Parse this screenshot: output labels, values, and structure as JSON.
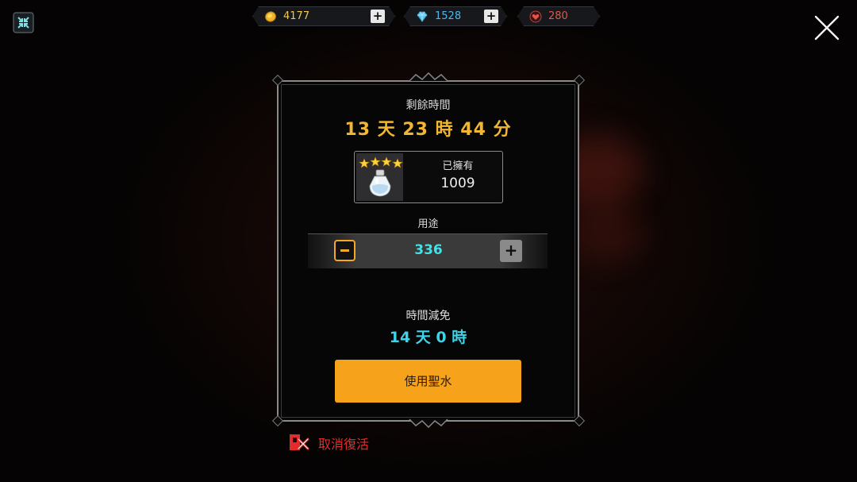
{
  "resources": {
    "gold": {
      "icon": "gold-coin-icon",
      "value": "4177",
      "plus": "+"
    },
    "gem": {
      "icon": "diamond-icon",
      "value": "1528",
      "plus": "+"
    },
    "heart": {
      "icon": "heart-icon",
      "value": "280"
    }
  },
  "panel": {
    "remaining_label": "剩餘時間",
    "remaining_time": "13 天 23 時 44 分",
    "owned_label": "已擁有",
    "owned_value": "1009",
    "item_icon": "holy-water-potion-icon",
    "item_stars": 4,
    "usage_label": "用途",
    "quantity": "336",
    "minus": "−",
    "plus": "+",
    "reduction_label": "時間減免",
    "reduction_value": "14 天 0 時",
    "use_button": "使用聖水"
  },
  "footer": {
    "cancel_revive": "取消復活"
  },
  "colors": {
    "accent_orange": "#f7a21b",
    "timer_gold": "#f2b632",
    "cyan": "#3fe3e8",
    "cancel_red": "#e22b2b"
  }
}
